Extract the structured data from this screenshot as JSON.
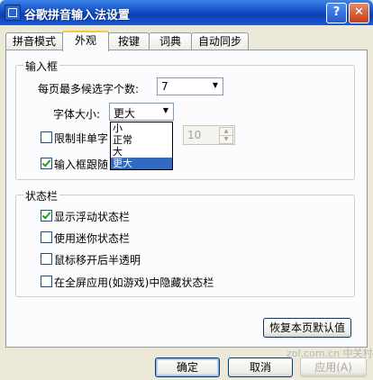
{
  "window": {
    "title": "谷歌拼音输入法设置",
    "help_label": "?",
    "close_label": "✕"
  },
  "tabs": [
    "拼音模式",
    "外观",
    "按键",
    "词典",
    "自动同步"
  ],
  "input_box": {
    "group_label": "输入框",
    "candidates_label": "每页最多候选字个数:",
    "candidates_value": "7",
    "font_size_label": "字体大小:",
    "font_size_value": "更大",
    "font_size_options": [
      "小",
      "正常",
      "大",
      "更大"
    ],
    "limit_label": "限制非单字",
    "limit_value": "10",
    "follow_label": "输入框跟随"
  },
  "status_bar": {
    "group_label": "状态栏",
    "options": [
      {
        "label": "显示浮动状态栏",
        "checked": true
      },
      {
        "label": "使用迷你状态栏",
        "checked": false
      },
      {
        "label": "鼠标移开后半透明",
        "checked": false
      },
      {
        "label": "在全屏应用(如游戏)中隐藏状态栏",
        "checked": false
      }
    ]
  },
  "buttons": {
    "restore": "恢复本页默认值",
    "ok": "确定",
    "cancel": "取消",
    "apply": "应用(A)"
  },
  "watermark": "zol.com.cn  中关村在线"
}
